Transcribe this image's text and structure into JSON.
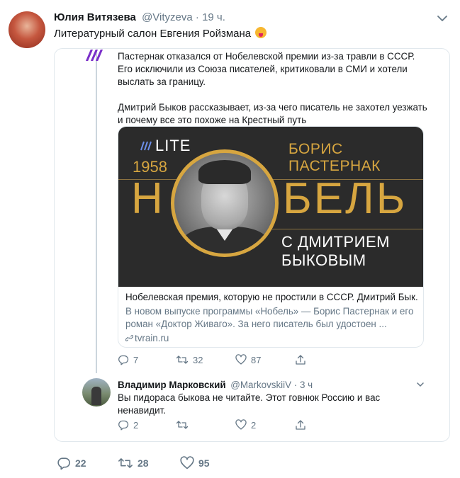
{
  "tweet": {
    "author_name": "Юлия Витязева",
    "author_handle": "@Vityzeva",
    "separator": " · ",
    "time": "19 ч.",
    "text": "Литературный салон Евгения Ройзмана",
    "emoji_icon": "squinting-tongue-emoji"
  },
  "quoted": {
    "paragraph1": "Пастернак отказался от Нобелевской премии из-за травли в СССР. Его исключили из Союза писателей, критиковали в СМИ и хотели выслать за границу.",
    "paragraph2": "Дмитрий Быков рассказывает, из-за чего писатель не захотел уезжать и почему все это похоже на Крестный путь",
    "card": {
      "image": {
        "brand": "LITE",
        "year": "1958",
        "name_line1": "БОРИС",
        "name_line2": "ПАСТЕРНАК",
        "title_left": "Н",
        "title_right": "БЕЛЬ",
        "subtitle_line1": "С ДМИТРИЕМ",
        "subtitle_line2": "БЫКОВЫМ"
      },
      "title": "Нобелевская премия, которую не простили в СССР. Дмитрий Бык...",
      "description": "В новом выпуске программы «Нобель» — Борис Пастернак и его роман «Доктор Живаго». За него писатель был удостоен ...",
      "domain": "tvrain.ru"
    },
    "actions": {
      "replies": "7",
      "retweets": "32",
      "likes": "87"
    }
  },
  "reply": {
    "author_name": "Владимир Марковский",
    "author_handle": "@MarkovskiiV",
    "separator": " · ",
    "time": "3 ч",
    "text": "Вы пидораса быкова не читайте. Этот говнюк Россию и вас ненавидит.",
    "actions": {
      "replies": "2",
      "retweets": "",
      "likes": "2"
    }
  },
  "main_actions": {
    "replies": "22",
    "retweets": "28",
    "likes": "95"
  },
  "colors": {
    "text": "#14171a",
    "muted": "#657786",
    "border": "#e1e8ed",
    "card_dark": "#2b2b2b",
    "gold": "#d7a640",
    "tvrain_purple": "#7b2fc9"
  }
}
